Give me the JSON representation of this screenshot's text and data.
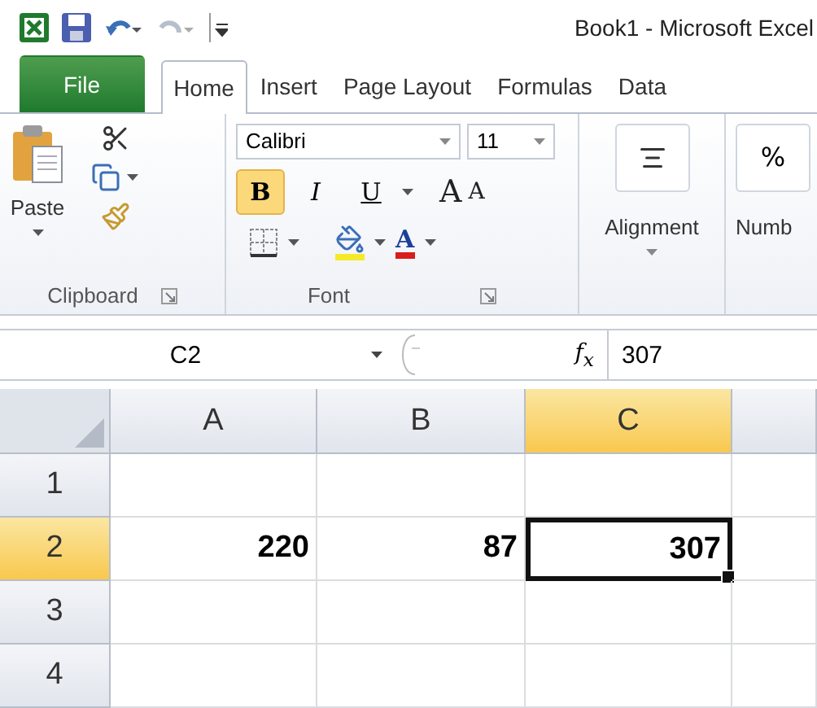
{
  "window": {
    "title": "Book1 - Microsoft Excel"
  },
  "tabs": [
    {
      "label": "File",
      "kind": "file",
      "selected": false
    },
    {
      "label": "Home",
      "kind": "tab",
      "selected": true
    },
    {
      "label": "Insert",
      "kind": "tab",
      "selected": false
    },
    {
      "label": "Page Layout",
      "kind": "tab",
      "selected": false
    },
    {
      "label": "Formulas",
      "kind": "tab",
      "selected": false
    },
    {
      "label": "Data",
      "kind": "tab",
      "selected": false
    }
  ],
  "ribbon": {
    "groups": [
      {
        "kind": "clipboard",
        "label": "Clipboard",
        "paste_label": "Paste"
      },
      {
        "kind": "font",
        "label": "Font",
        "font_name": "Calibri",
        "font_size": "11",
        "styles": [
          {
            "label": "B",
            "selected": true
          },
          {
            "label": "I",
            "selected": false
          },
          {
            "label": "U",
            "selected": false
          }
        ],
        "grow": "A",
        "shrink": "A",
        "color_letter": "A"
      },
      {
        "kind": "alignment",
        "label": "Alignment"
      },
      {
        "kind": "number",
        "label": "Numb",
        "symbol": "%"
      }
    ]
  },
  "formula_bar": {
    "name_box": "C2",
    "function_label": "f$_{x}$",
    "formula": "307"
  },
  "sheet": {
    "columns": [
      {
        "label": "A",
        "selected": false
      },
      {
        "label": "B",
        "selected": false
      },
      {
        "label": "C",
        "selected": true
      }
    ],
    "rows": [
      {
        "label": "1",
        "selected": false
      },
      {
        "label": "2",
        "selected": true,
        "cells": [
          {
            "value": "220",
            "active": false
          },
          {
            "value": "87",
            "active": false
          },
          {
            "value": "307",
            "active": true
          }
        ]
      },
      {
        "label": "3",
        "selected": false
      },
      {
        "label": "4",
        "selected": false
      }
    ]
  }
}
